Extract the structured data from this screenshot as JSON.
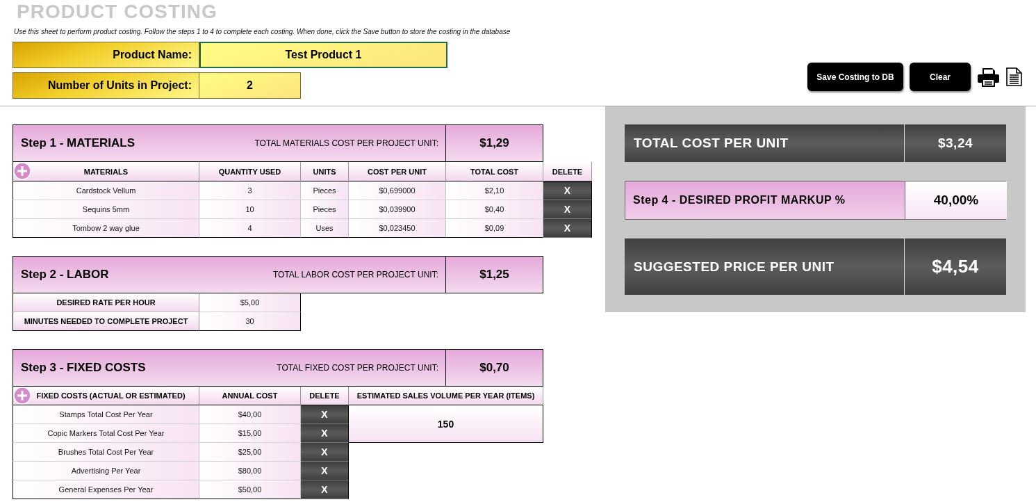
{
  "title": "PRODUCT COSTING",
  "instructions": "Use this sheet to perform product costing. Follow the steps 1 to 4 to complete each costing. When done, click the Save button to store the costing in the database",
  "product_name": {
    "label": "Product Name:",
    "value": "Test Product 1"
  },
  "units": {
    "label": "Number of Units in Project:",
    "value": "2"
  },
  "buttons": [
    {
      "label": "Save Costing to DB"
    },
    {
      "label": "Clear"
    }
  ],
  "materials": {
    "title": "Step 1 - MATERIALS",
    "total_label": "TOTAL MATERIALS COST PER PROJECT UNIT:",
    "total": "$1,29",
    "columns": [
      "MATERIALS",
      "QUANTITY USED",
      "UNITS",
      "COST PER UNIT",
      "TOTAL COST",
      "DELETE"
    ],
    "rows": [
      {
        "cells": [
          "Cardstock Vellum",
          "3",
          "Pieces",
          "$0,699000",
          "$2,10"
        ],
        "delete": "X"
      },
      {
        "cells": [
          "Sequins 5mm",
          "10",
          "Pieces",
          "$0,039900",
          "$0,40"
        ],
        "delete": "X"
      },
      {
        "cells": [
          "Tombow 2 way glue",
          "4",
          "Uses",
          "$0,023450",
          "$0,09"
        ],
        "delete": "X"
      }
    ]
  },
  "labor": {
    "title": "Step 2 - LABOR",
    "total_label": "TOTAL LABOR COST PER PROJECT UNIT:",
    "total": "$1,25",
    "rows": [
      {
        "label": "DESIRED RATE PER HOUR",
        "value": "$5,00"
      },
      {
        "label": "MINUTES NEEDED TO COMPLETE PROJECT",
        "value": "30"
      }
    ]
  },
  "fixed_costs": {
    "title": "Step 3 - FIXED COSTS",
    "total_label": "TOTAL FIXED COST PER PROJECT UNIT:",
    "total": "$0,70",
    "columns": [
      "FIXED COSTS (ACTUAL OR ESTIMATED)",
      "ANNUAL COST",
      "DELETE"
    ],
    "rows": [
      {
        "cells": [
          "Stamps Total Cost Per Year",
          "$40,00"
        ],
        "delete": "X"
      },
      {
        "cells": [
          "Copic Markers Total Cost Per Year",
          "$15,00"
        ],
        "delete": "X"
      },
      {
        "cells": [
          "Brushes Total Cost Per Year",
          "$25,00"
        ],
        "delete": "X"
      },
      {
        "cells": [
          "Advertising Per Year",
          "$80,00"
        ],
        "delete": "X"
      },
      {
        "cells": [
          "General Expenses Per Year",
          "$50,00"
        ],
        "delete": "X"
      }
    ],
    "sales_volume": {
      "label": "ESTIMATED SALES VOLUME PER YEAR (ITEMS)",
      "value": "150"
    }
  },
  "summary": {
    "total_cost": {
      "label": "TOTAL COST PER UNIT",
      "value": "$3,24"
    },
    "markup": {
      "label": "Step 4 - DESIRED PROFIT MARKUP %",
      "value": "40,00%"
    },
    "suggested_price": {
      "label": "SUGGESTED PRICE PER UNIT",
      "value": "$4,54"
    }
  }
}
